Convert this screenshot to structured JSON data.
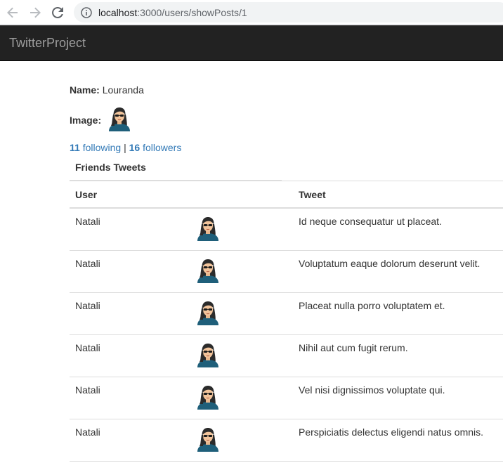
{
  "browser": {
    "url_host": "localhost",
    "url_path": ":3000/users/showPosts/1"
  },
  "navbar": {
    "brand": "TwitterProject"
  },
  "profile": {
    "name_label": "Name:",
    "name": "Louranda",
    "image_label": "Image:",
    "following_count": "11",
    "following_label": "following",
    "separator": "|",
    "followers_count": "16",
    "followers_label": "followers"
  },
  "tweets_section": {
    "heading": "Friends Tweets",
    "columns": [
      "User",
      "",
      "Tweet"
    ],
    "rows": [
      {
        "user": "Natali",
        "avatar": "woman-avatar-icon",
        "tweet": "Id neque consequatur ut placeat."
      },
      {
        "user": "Natali",
        "avatar": "woman-avatar-icon",
        "tweet": "Voluptatum eaque dolorum deserunt velit."
      },
      {
        "user": "Natali",
        "avatar": "woman-avatar-icon",
        "tweet": "Placeat nulla porro voluptatem et."
      },
      {
        "user": "Natali",
        "avatar": "woman-avatar-icon",
        "tweet": "Nihil aut cum fugit rerum."
      },
      {
        "user": "Natali",
        "avatar": "woman-avatar-icon",
        "tweet": "Vel nisi dignissimos voluptate qui."
      },
      {
        "user": "Natali",
        "avatar": "woman-avatar-icon",
        "tweet": "Perspiciatis delectus eligendi natus omnis."
      }
    ]
  },
  "colors": {
    "navbar_bg": "#222222",
    "brand_text": "#9d9d9d",
    "link": "#337ab7",
    "avatar_shirt": "#1f5f7a",
    "avatar_hair": "#2b2b2b",
    "avatar_skin": "#f2c49b"
  }
}
